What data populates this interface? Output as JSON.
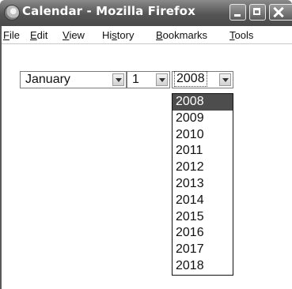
{
  "window": {
    "title": "Calendar - Mozilla Firefox",
    "app_icon": "firefox-logo-icon",
    "buttons": {
      "minimize_icon": "minimize-icon",
      "maximize_icon": "maximize-icon",
      "close_icon": "close-icon"
    }
  },
  "menubar": {
    "items": [
      {
        "accel": "F",
        "rest": "ile"
      },
      {
        "accel": "E",
        "rest": "dit"
      },
      {
        "accel": "V",
        "rest": "iew"
      },
      {
        "pre": "Hi",
        "accel": "s",
        "rest": "tory"
      },
      {
        "accel": "B",
        "rest": "ookmarks"
      },
      {
        "accel": "T",
        "rest": "ools"
      }
    ]
  },
  "form": {
    "month_value": "January",
    "day_value": "1",
    "year_value": "2008"
  },
  "year_dropdown": {
    "options": [
      "2008",
      "2009",
      "2010",
      "2011",
      "2012",
      "2013",
      "2014",
      "2015",
      "2016",
      "2017",
      "2018"
    ],
    "selected": "2008"
  },
  "colors": {
    "titlebar": "#555555",
    "selection": "#4d4d4d"
  }
}
